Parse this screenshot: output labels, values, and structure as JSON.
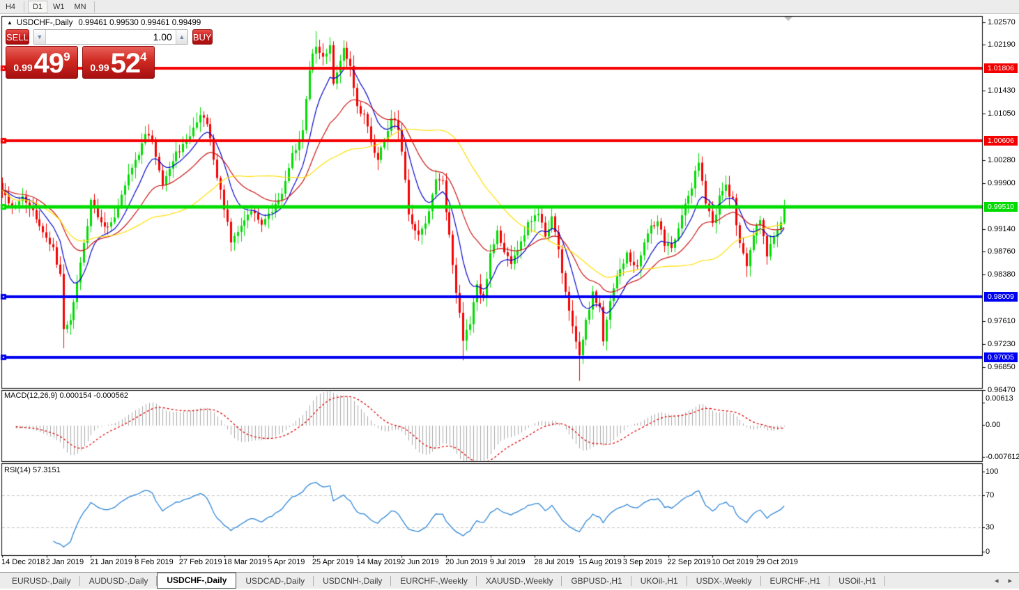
{
  "toolbar": {
    "timeframes": [
      "H4",
      "D1",
      "W1",
      "MN"
    ],
    "active": "D1"
  },
  "chart_header": {
    "collapse_icon": "▲",
    "symbol": "USDCHF-,Daily",
    "ohlc": "0.99461 0.99530 0.99461 0.99499"
  },
  "trade_panel": {
    "sell_label": "SELL",
    "buy_label": "BUY",
    "volume": "1.00",
    "stepper_down_icon": "▼",
    "stepper_up_icon": "▲",
    "sell_price": {
      "small": "0.99",
      "big": "49",
      "sup": "9"
    },
    "buy_price": {
      "small": "0.99",
      "big": "52",
      "sup": "4"
    }
  },
  "price_axis": {
    "ticks": [
      "1.02570",
      "1.02190",
      "1.01430",
      "1.01050",
      "1.00280",
      "0.99900",
      "0.99140",
      "0.98760",
      "0.98380",
      "0.97610",
      "0.97230",
      "0.96850",
      "0.96470"
    ]
  },
  "hlines": [
    {
      "price": 1.01806,
      "label": "1.01806",
      "color": "#f40000",
      "width": 4
    },
    {
      "price": 1.00606,
      "label": "1.00606",
      "color": "#f40000",
      "width": 4
    },
    {
      "price": 0.9951,
      "label": "0.99510",
      "color": "#00dc00",
      "width": 5
    },
    {
      "price": 0.98009,
      "label": "0.98009",
      "color": "#0000f0",
      "width": 4
    },
    {
      "price": 0.97005,
      "label": "0.97005",
      "color": "#0000f0",
      "width": 4
    }
  ],
  "macd_panel": {
    "title": "MACD(12,26,9)",
    "values": "0.000154 -0.000562",
    "axis_max": "0.00613",
    "axis_zero": "0.00",
    "axis_min": "-0.007612"
  },
  "rsi_panel": {
    "title": "RSI(14)",
    "value": "57.3151",
    "axis": [
      "100",
      "70",
      "30",
      "0"
    ],
    "levels": [
      70,
      30
    ]
  },
  "time_axis": {
    "labels": [
      "14 Dec 2018",
      "2 Jan 2019",
      "21 Jan 2019",
      "8 Feb 2019",
      "27 Feb 2019",
      "18 Mar 2019",
      "5 Apr 2019",
      "25 Apr 2019",
      "14 May 2019",
      "2 Jun 2019",
      "20 Jun 2019",
      "9 Jul 2019",
      "28 Jul 2019",
      "15 Aug 2019",
      "3 Sep 2019",
      "22 Sep 2019",
      "10 Oct 2019",
      "29 Oct 2019"
    ]
  },
  "tabs": {
    "items": [
      "EURUSD-,Daily",
      "AUDUSD-,Daily",
      "USDCHF-,Daily",
      "USDCAD-,Daily",
      "USDCNH-,Daily",
      "EURCHF-,Weekly",
      "XAUUSD-,Weekly",
      "GBPUSD-,H1",
      "UKOil-,H1",
      "USDX-,Weekly",
      "EURCHF-,H1",
      "USOil-,H1"
    ],
    "active": "USDCHF-,Daily",
    "scroll_left_icon": "◂",
    "scroll_right_icon": "▸"
  },
  "chart_data": {
    "type": "candlestick",
    "title": "USDCHF Daily",
    "n_candles": 230,
    "price_range_visible": [
      0.9647,
      1.0257
    ],
    "bull_color": "#00dc00",
    "bear_color": "#f40000",
    "close_anchors": [
      [
        0,
        0.9975
      ],
      [
        3,
        0.9952
      ],
      [
        6,
        0.9965
      ],
      [
        9,
        0.994
      ],
      [
        12,
        0.991
      ],
      [
        15,
        0.988
      ],
      [
        17,
        0.984
      ],
      [
        18,
        0.9745
      ],
      [
        20,
        0.976
      ],
      [
        23,
        0.9855
      ],
      [
        26,
        0.9958
      ],
      [
        30,
        0.9915
      ],
      [
        33,
        0.993
      ],
      [
        36,
        0.9985
      ],
      [
        40,
        1.004
      ],
      [
        42,
        1.0075
      ],
      [
        44,
        1.006
      ],
      [
        47,
        0.999
      ],
      [
        50,
        1.003
      ],
      [
        54,
        1.006
      ],
      [
        58,
        1.0105
      ],
      [
        60,
        1.009
      ],
      [
        63,
        1.0
      ],
      [
        67,
        0.9895
      ],
      [
        70,
        0.992
      ],
      [
        73,
        0.9945
      ],
      [
        76,
        0.992
      ],
      [
        79,
        0.9945
      ],
      [
        82,
        0.9975
      ],
      [
        85,
        1.0035
      ],
      [
        88,
        1.008
      ],
      [
        90,
        1.018
      ],
      [
        92,
        1.022
      ],
      [
        94,
        1.02
      ],
      [
        96,
        1.0215
      ],
      [
        97,
        1.015
      ],
      [
        99,
        1.019
      ],
      [
        100,
        1.0215
      ],
      [
        102,
        1.018
      ],
      [
        104,
        1.012
      ],
      [
        106,
        1.01
      ],
      [
        108,
        1.006
      ],
      [
        110,
        1.003
      ],
      [
        112,
        1.006
      ],
      [
        114,
        1.01
      ],
      [
        116,
        1.008
      ],
      [
        118,
        1.0
      ],
      [
        119,
        0.9935
      ],
      [
        122,
        0.9905
      ],
      [
        124,
        0.992
      ],
      [
        127,
        1.0
      ],
      [
        129,
        0.999
      ],
      [
        131,
        0.99
      ],
      [
        133,
        0.981
      ],
      [
        135,
        0.973
      ],
      [
        137,
        0.976
      ],
      [
        139,
        0.982
      ],
      [
        141,
        0.98
      ],
      [
        143,
        0.987
      ],
      [
        145,
        0.991
      ],
      [
        147,
        0.988
      ],
      [
        149,
        0.9855
      ],
      [
        151,
        0.988
      ],
      [
        154,
        0.992
      ],
      [
        157,
        0.994
      ],
      [
        159,
        0.9905
      ],
      [
        161,
        0.993
      ],
      [
        163,
        0.988
      ],
      [
        165,
        0.981
      ],
      [
        167,
        0.975
      ],
      [
        169,
        0.97
      ],
      [
        171,
        0.976
      ],
      [
        173,
        0.981
      ],
      [
        175,
        0.978
      ],
      [
        176,
        0.973
      ],
      [
        178,
        0.979
      ],
      [
        180,
        0.984
      ],
      [
        183,
        0.987
      ],
      [
        186,
        0.985
      ],
      [
        189,
        0.991
      ],
      [
        192,
        0.993
      ],
      [
        194,
        0.989
      ],
      [
        196,
        0.988
      ],
      [
        198,
        0.992
      ],
      [
        200,
        0.996
      ],
      [
        202,
        0.9985
      ],
      [
        204,
        1.0025
      ],
      [
        206,
        0.996
      ],
      [
        208,
        0.992
      ],
      [
        210,
        0.9965
      ],
      [
        212,
        0.9985
      ],
      [
        214,
        0.996
      ],
      [
        216,
        0.989
      ],
      [
        218,
        0.985
      ],
      [
        220,
        0.99
      ],
      [
        222,
        0.993
      ],
      [
        224,
        0.987
      ],
      [
        226,
        0.99
      ],
      [
        228,
        0.993
      ],
      [
        229,
        0.99499
      ]
    ],
    "spikes": [
      {
        "i": 18,
        "low": 0.9716
      },
      {
        "i": 92,
        "high": 1.0242
      },
      {
        "i": 100,
        "high": 1.0225
      },
      {
        "i": 135,
        "low": 0.9696
      },
      {
        "i": 169,
        "low": 0.9662
      },
      {
        "i": 176,
        "low": 0.9727
      },
      {
        "i": 204,
        "high": 1.003
      }
    ],
    "moving_averages": [
      {
        "type": "ema",
        "period": 10,
        "color": "#0000cc"
      },
      {
        "type": "ema",
        "period": 25,
        "color": "#cc1111"
      },
      {
        "type": "sma",
        "period": 45,
        "color": "#ffdf00"
      }
    ],
    "macd": {
      "fast": 12,
      "slow": 26,
      "signal": 9,
      "histogram_color": "#a9a9a9",
      "signal_color": "#e00000",
      "axis_max_value": 0.00613,
      "axis_min_value": -0.007612
    },
    "rsi": {
      "period": 14,
      "color": "#2f86d7",
      "levels": [
        70,
        30
      ]
    }
  }
}
